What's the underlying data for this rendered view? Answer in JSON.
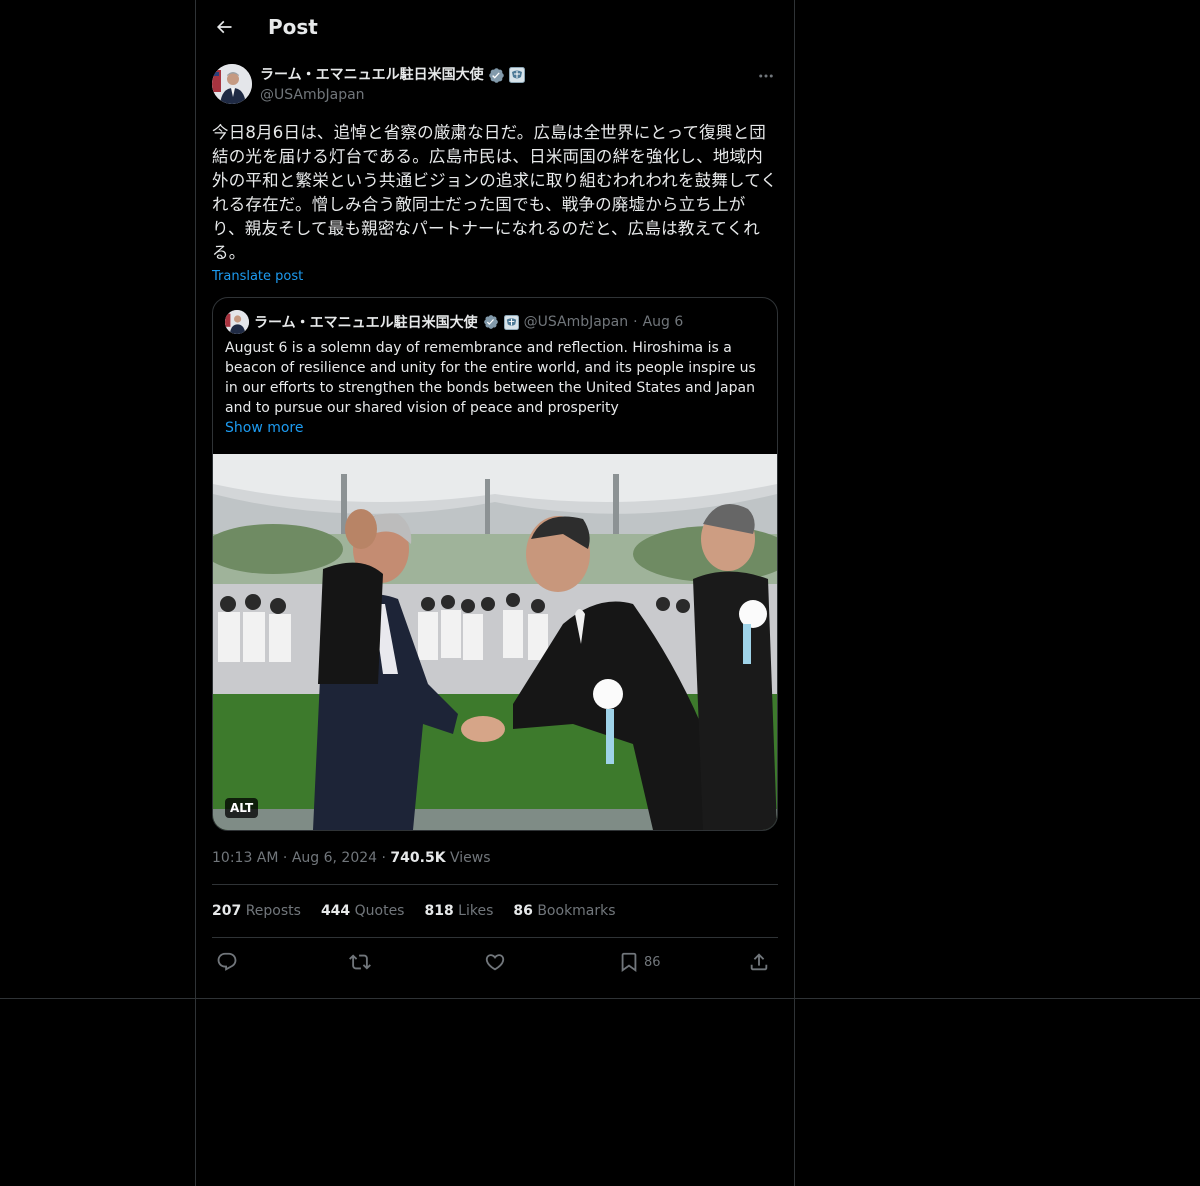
{
  "header": {
    "title": "Post"
  },
  "post": {
    "author_name": "ラーム・エマニュエル駐日米国大使",
    "author_handle": "@USAmbJapan",
    "text": "今日8月6日は、追悼と省察の厳粛な日だ。広島は全世界にとって復興と団結の光を届ける灯台である。広島市民は、日米両国の絆を強化し、地域内外の平和と繁栄という共通ビジョンの追求に取り組むわれわれを鼓舞してくれる存在だ。憎しみ合う敵同士だった国でも、戦争の廃墟から立ち上がり、親友そして最も親密なパートナーになれるのだと、広島は教えてくれる。",
    "translate_label": "Translate post",
    "time": "10:13 AM",
    "date": "Aug 6, 2024",
    "views_count": "740.5K",
    "views_label": "Views"
  },
  "quote": {
    "author_name": "ラーム・エマニュエル駐日米国大使",
    "author_handle": "@USAmbJapan",
    "date": "Aug 6",
    "text": "August 6 is a solemn day of remembrance and reflection. Hiroshima is a beacon of resilience and unity for the entire world, and its people inspire us in our efforts to strengthen the bonds between the United States and Japan and to pursue our shared vision of peace and prosperity",
    "show_more": "Show more",
    "alt_label": "ALT"
  },
  "stats": [
    {
      "count": "207",
      "label": "Reposts"
    },
    {
      "count": "444",
      "label": "Quotes"
    },
    {
      "count": "818",
      "label": "Likes"
    },
    {
      "count": "86",
      "label": "Bookmarks"
    }
  ],
  "actions": {
    "bookmark_count": "86"
  },
  "icons": {
    "back": "arrow-left-icon",
    "more": "more-horizontal-icon",
    "verified": "verified-badge-icon",
    "affiliation": "us-government-seal-icon",
    "reply": "reply-icon",
    "repost": "repost-icon",
    "like": "heart-icon",
    "bookmark": "bookmark-icon",
    "share": "share-icon"
  },
  "colors": {
    "background": "#000000",
    "border": "#2f3336",
    "text": "#e7e9ea",
    "secondary_text": "#71767b",
    "accent": "#1d9bf0",
    "verified": "#829aab"
  }
}
